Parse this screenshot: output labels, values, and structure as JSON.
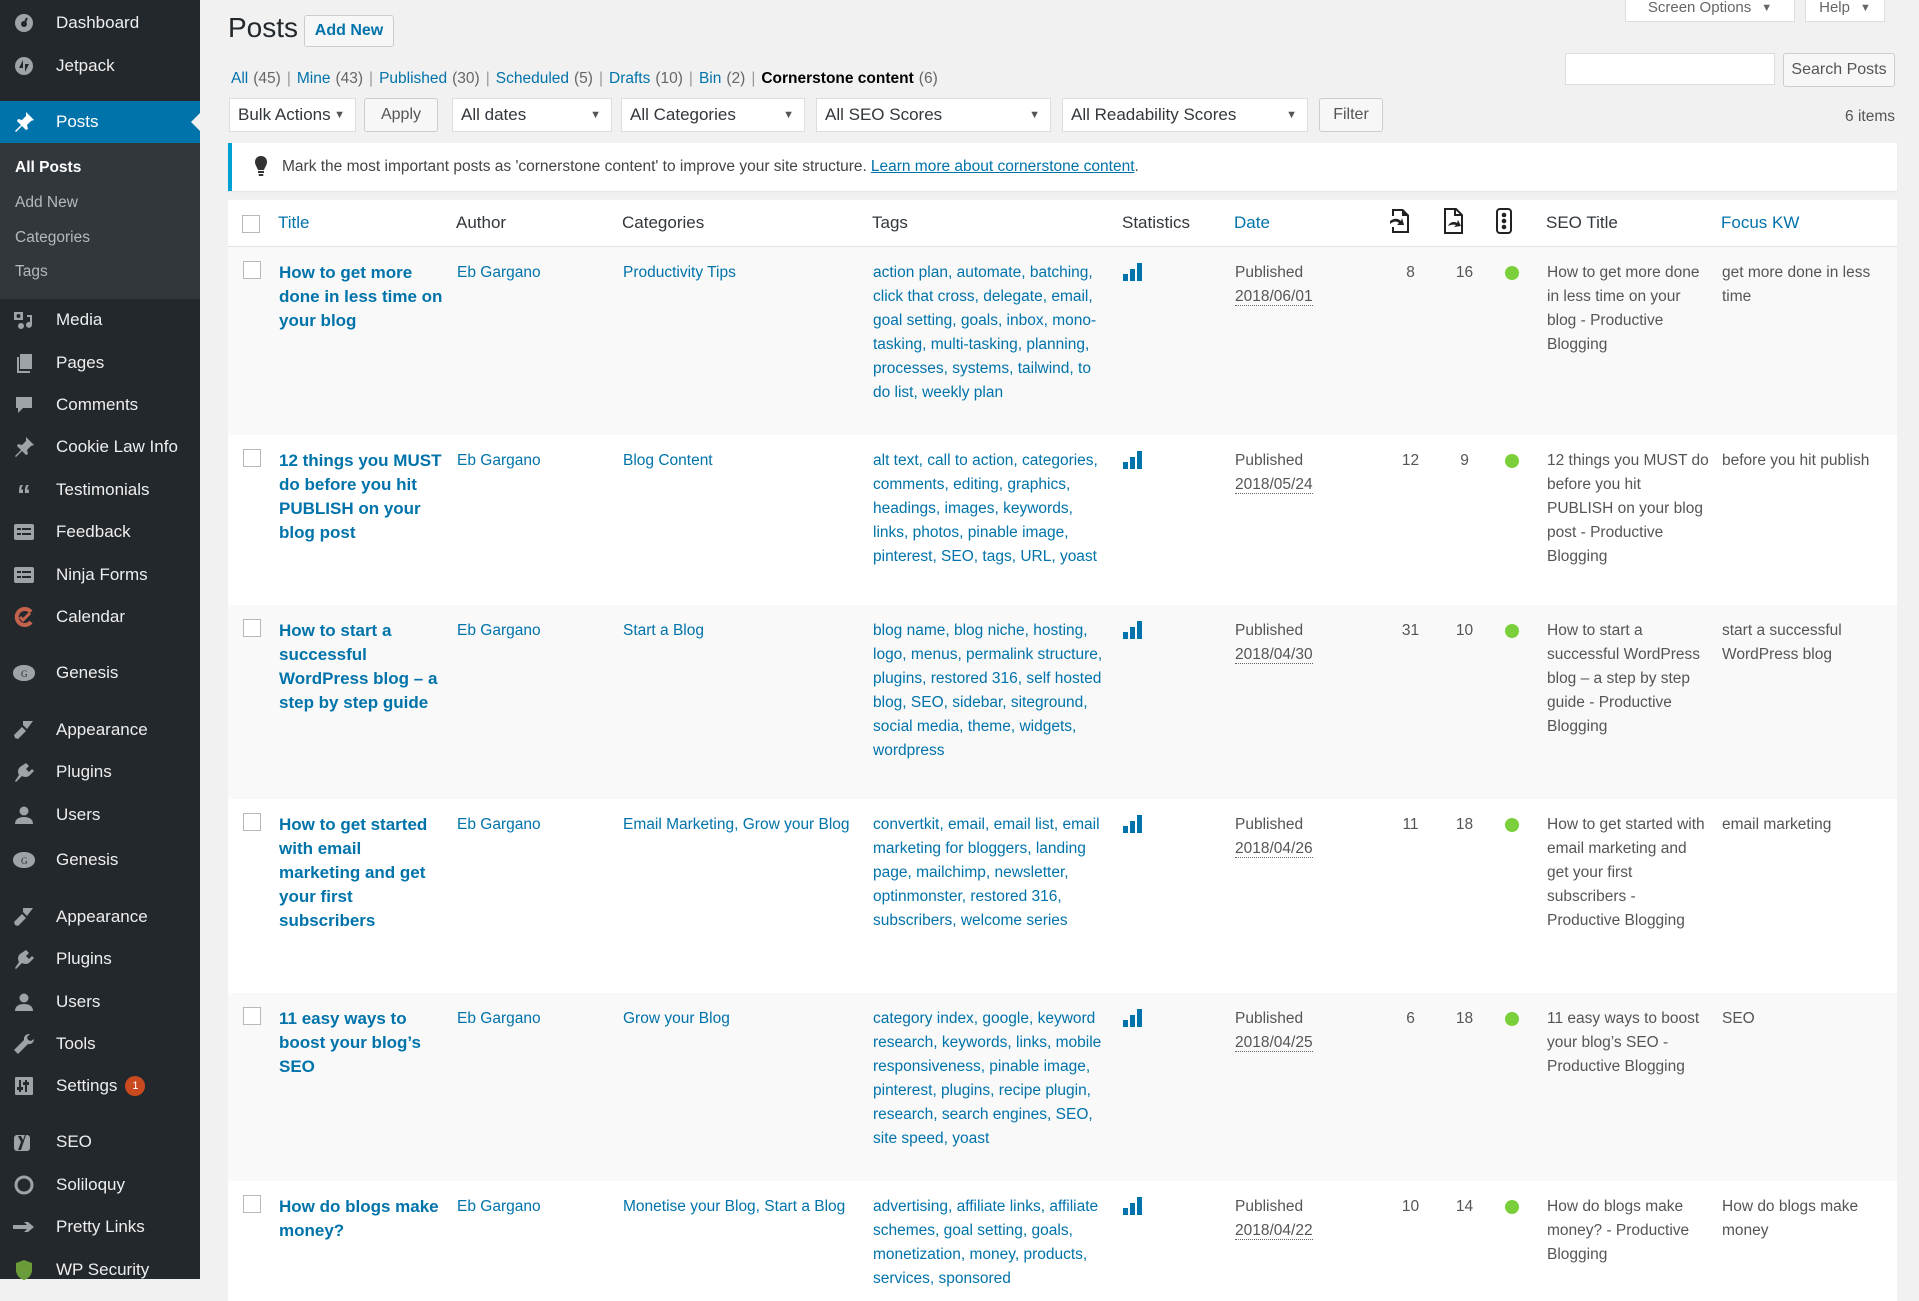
{
  "sidebar": {
    "items": [
      {
        "label": "Dashboard",
        "icon": "dashboard-icon"
      },
      {
        "label": "Jetpack",
        "icon": "jetpack-icon"
      },
      {
        "label": "Posts",
        "icon": "pushpin-icon",
        "active": true
      },
      {
        "label": "Media",
        "icon": "media-icon"
      },
      {
        "label": "Pages",
        "icon": "pages-icon"
      },
      {
        "label": "Comments",
        "icon": "comment-icon"
      },
      {
        "label": "Cookie Law Info",
        "icon": "pushpin-icon"
      },
      {
        "label": "Testimonials",
        "icon": "quote-icon"
      },
      {
        "label": "Feedback",
        "icon": "feedback-icon"
      },
      {
        "label": "Ninja Forms",
        "icon": "forms-icon"
      },
      {
        "label": "Calendar",
        "icon": "calendar-icon"
      },
      {
        "label": "Genesis",
        "icon": "genesis-icon"
      },
      {
        "label": "Appearance",
        "icon": "brush-icon"
      },
      {
        "label": "Plugins",
        "icon": "plug-icon"
      },
      {
        "label": "Users",
        "icon": "user-icon"
      },
      {
        "label": "Genesis",
        "icon": "genesis-icon"
      },
      {
        "label": "Appearance",
        "icon": "brush-icon"
      },
      {
        "label": "Plugins",
        "icon": "plug-icon"
      },
      {
        "label": "Users",
        "icon": "user-icon"
      },
      {
        "label": "Tools",
        "icon": "wrench-icon"
      },
      {
        "label": "Settings",
        "icon": "settings-icon",
        "badge": "1"
      },
      {
        "label": "SEO",
        "icon": "yoast-icon"
      },
      {
        "label": "Soliloquy",
        "icon": "soliloquy-icon"
      },
      {
        "label": "Pretty Links",
        "icon": "star-icon"
      },
      {
        "label": "WP Security",
        "icon": "shield-icon"
      }
    ],
    "submenu": [
      {
        "label": "All Posts",
        "current": true
      },
      {
        "label": "Add New"
      },
      {
        "label": "Categories"
      },
      {
        "label": "Tags"
      }
    ]
  },
  "header": {
    "title": "Posts",
    "add_new": "Add New",
    "screen_options": "Screen Options",
    "help": "Help"
  },
  "views": [
    {
      "label": "All",
      "count": "(45)"
    },
    {
      "label": "Mine",
      "count": "(43)"
    },
    {
      "label": "Published",
      "count": "(30)"
    },
    {
      "label": "Scheduled",
      "count": "(5)"
    },
    {
      "label": "Drafts",
      "count": "(10)"
    },
    {
      "label": "Bin",
      "count": "(2)"
    },
    {
      "label": "Cornerstone content",
      "count": "(6)",
      "current": true
    }
  ],
  "search": {
    "button": "Search Posts",
    "value": ""
  },
  "filters": {
    "bulk_actions": "Bulk Actions",
    "apply": "Apply",
    "dates": "All dates",
    "categories": "All Categories",
    "seo_scores": "All SEO Scores",
    "readability": "All Readability Scores",
    "filter": "Filter",
    "items_count": "6 items"
  },
  "notice": {
    "text": "Mark the most important posts as 'cornerstone content' to improve your site structure. ",
    "link": "Learn more about cornerstone content",
    "after": "."
  },
  "table": {
    "headers": {
      "title": "Title",
      "author": "Author",
      "categories": "Categories",
      "tags": "Tags",
      "statistics": "Statistics",
      "date": "Date",
      "incoming_links": "incoming-links-icon",
      "outgoing_links": "outgoing-links-icon",
      "readability": "traffic-light-icon",
      "seo_title": "SEO Title",
      "focus_kw": "Focus KW"
    },
    "rows": [
      {
        "title": "How to get more done in less time on your blog",
        "author": "Eb Gargano",
        "categories": "Productivity Tips",
        "tags": "action plan, automate, batching, click that cross, delegate, email, goal setting, goals, inbox, mono-tasking, multi-tasking, planning, processes, systems, tailwind, to do list, weekly plan",
        "status": "Published",
        "date": "2018/06/01",
        "links_in": "8",
        "links_out": "16",
        "seo_status": "#7ad03a",
        "seo_title": "How to get more done in less time on your blog - Productive Blogging",
        "focus_kw": "get more done in less time"
      },
      {
        "title": "12 things you MUST do before you hit PUBLISH on your blog post",
        "author": "Eb Gargano",
        "categories": "Blog Content",
        "tags": "alt text, call to action, categories, comments, editing, graphics, headings, images, keywords, links, photos, pinable image, pinterest, SEO, tags, URL, yoast",
        "status": "Published",
        "date": "2018/05/24",
        "links_in": "12",
        "links_out": "9",
        "seo_status": "#7ad03a",
        "seo_title": "12 things you MUST do before you hit PUBLISH on your blog post - Productive Blogging",
        "focus_kw": "before you hit publish"
      },
      {
        "title": "How to start a successful WordPress blog – a step by step guide",
        "author": "Eb Gargano",
        "categories": "Start a Blog",
        "tags": "blog name, blog niche, hosting, logo, menus, permalink structure, plugins, restored 316, self hosted blog, SEO, sidebar, siteground, social media, theme, widgets, wordpress",
        "status": "Published",
        "date": "2018/04/30",
        "links_in": "31",
        "links_out": "10",
        "seo_status": "#7ad03a",
        "seo_title": "How to start a successful WordPress blog – a step by step guide - Productive Blogging",
        "focus_kw": "start a successful WordPress blog"
      },
      {
        "title": "How to get started with email marketing and get your first subscribers",
        "author": "Eb Gargano",
        "categories": "Email Marketing, Grow your Blog",
        "tags": "convertkit, email, email list, email marketing for bloggers, landing page, mailchimp, newsletter, optinmonster, restored 316, subscribers, welcome series",
        "status": "Published",
        "date": "2018/04/26",
        "links_in": "11",
        "links_out": "18",
        "seo_status": "#7ad03a",
        "seo_title": "How to get started with email marketing and get your first subscribers - Productive Blogging",
        "focus_kw": "email marketing"
      },
      {
        "title": "11 easy ways to boost your blog’s SEO",
        "author": "Eb Gargano",
        "categories": "Grow your Blog",
        "tags": "category index, google, keyword research, keywords, links, mobile responsiveness, pinable image, pinterest, plugins, recipe plugin, research, search engines, SEO, site speed, yoast",
        "status": "Published",
        "date": "2018/04/25",
        "links_in": "6",
        "links_out": "18",
        "seo_status": "#7ad03a",
        "seo_title": "11 easy ways to boost your blog’s SEO - Productive Blogging",
        "focus_kw": "SEO"
      },
      {
        "title": "How do blogs make money?",
        "author": "Eb Gargano",
        "categories": "Monetise your Blog, Start a Blog",
        "tags": "advertising, affiliate links, affiliate schemes, goal setting, goals, monetization, money, products, services, sponsored",
        "status": "Published",
        "date": "2018/04/22",
        "links_in": "10",
        "links_out": "14",
        "seo_status": "#7ad03a",
        "seo_title": "How do blogs make money? - Productive Blogging",
        "focus_kw": "How do blogs make money"
      }
    ]
  }
}
